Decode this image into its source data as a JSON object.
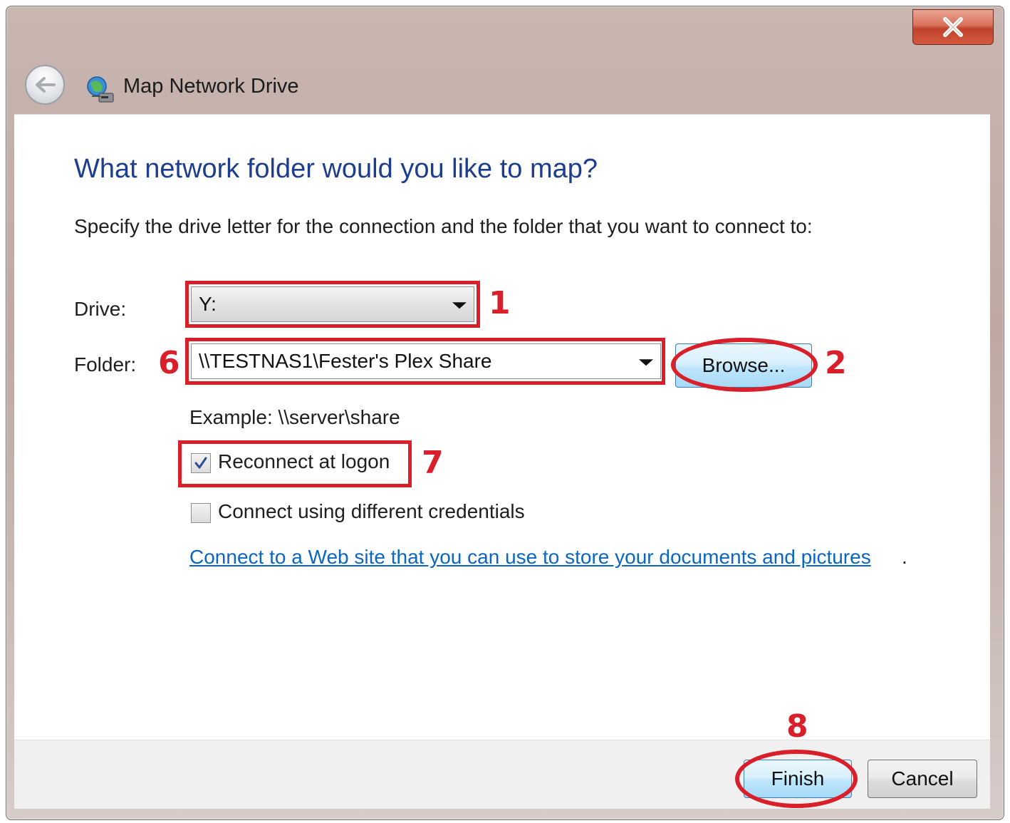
{
  "window": {
    "title": "Map Network Drive",
    "close_label": "X"
  },
  "content": {
    "heading": "What network folder would you like to map?",
    "instruction": "Specify the drive letter for the connection and the folder that you want to connect to:",
    "drive_label": "Drive:",
    "drive_value": "Y:",
    "folder_label": "Folder:",
    "folder_value": "\\\\TESTNAS1\\Fester's Plex Share",
    "browse_label": "Browse...",
    "example_text": "Example: \\\\server\\share",
    "reconnect_label": "Reconnect at logon",
    "reconnect_checked": true,
    "credentials_label": "Connect using different credentials",
    "credentials_checked": false,
    "link_text": "Connect to a Web site that you can use to store your documents and pictures",
    "link_suffix": "."
  },
  "footer": {
    "finish_label": "Finish",
    "cancel_label": "Cancel"
  },
  "annotations": {
    "n1": "1",
    "n2": "2",
    "n6": "6",
    "n7": "7",
    "n8": "8",
    "color": "#d9202a"
  },
  "colors": {
    "heading": "#1d3d8f",
    "link": "#0b66c2",
    "close_button": "#c2412c"
  }
}
